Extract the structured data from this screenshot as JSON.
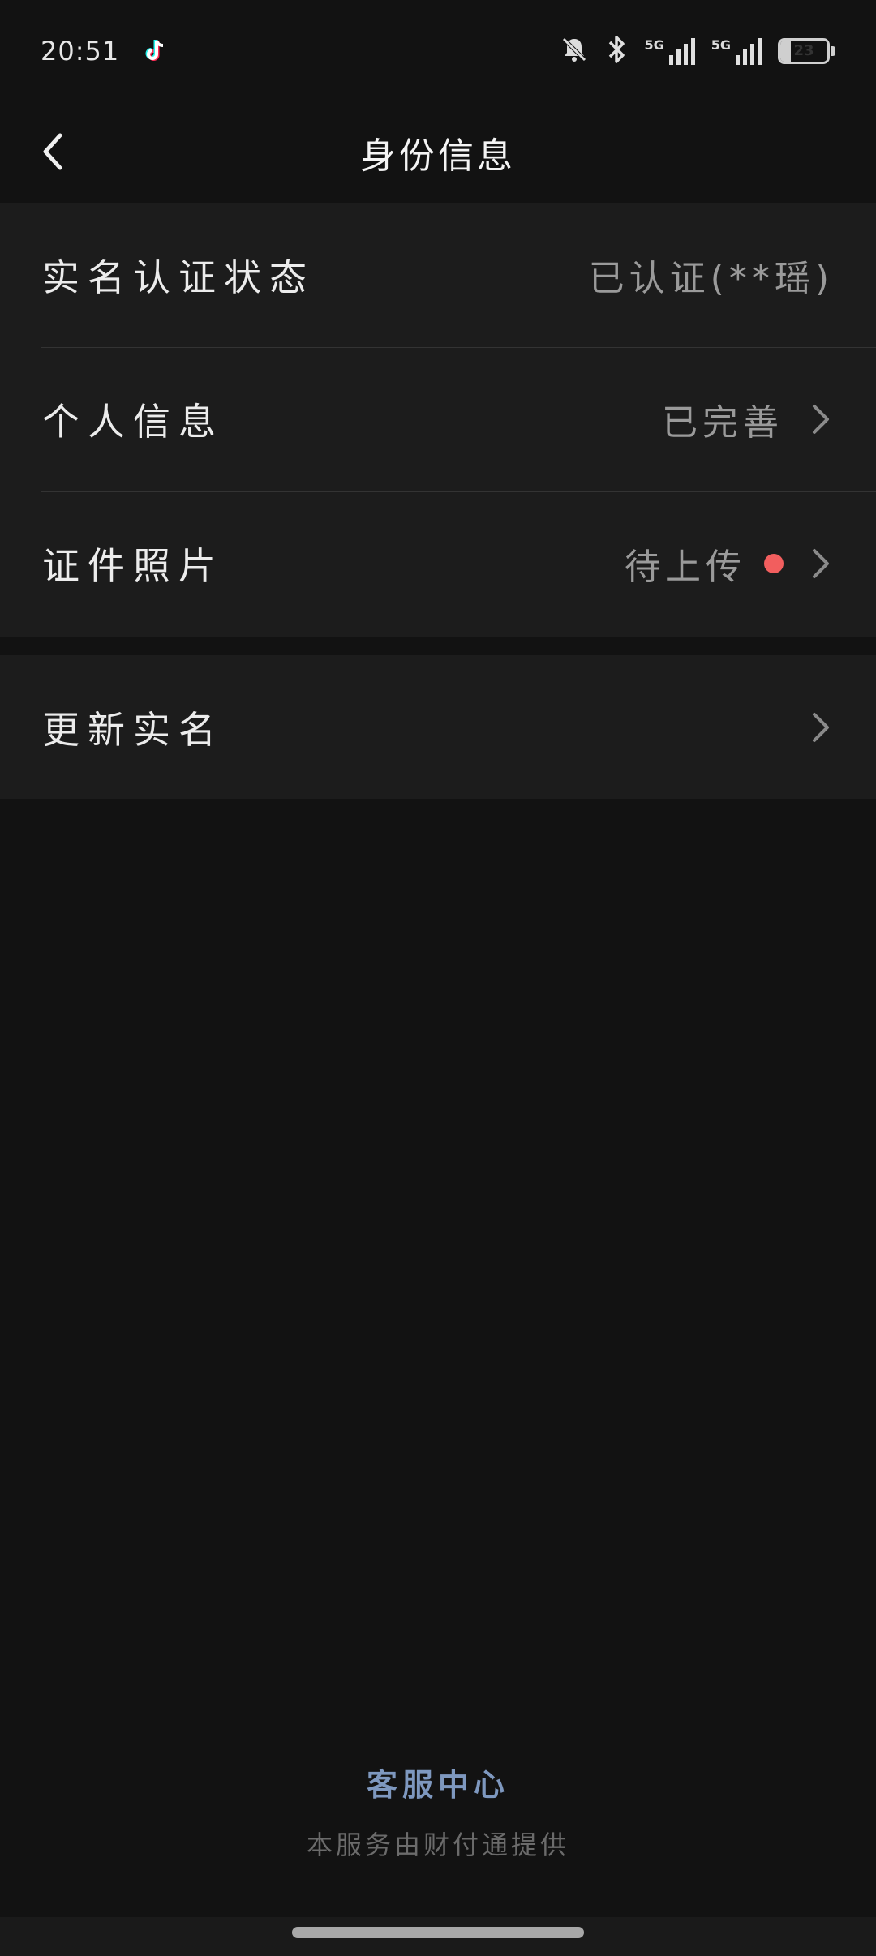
{
  "status_bar": {
    "time": "20:51",
    "app_icon": "tiktok-icon",
    "icons": [
      "bell-muted-icon",
      "bluetooth-icon",
      "signal-5g-icon",
      "signal-5g-icon"
    ],
    "signal_label_1": "5G",
    "signal_label_2": "5G",
    "battery_level": "23",
    "battery_fraction": 0.23
  },
  "header": {
    "title": "身份信息",
    "back_icon": "chevron-left-icon"
  },
  "info_group": {
    "items": [
      {
        "label": "实名认证状态",
        "value": "已认证(**瑶)",
        "has_chevron": false
      },
      {
        "label": "个人信息",
        "value": "已完善",
        "has_chevron": true
      },
      {
        "label": "证件照片",
        "value": "待上传",
        "has_chevron": true,
        "badge_color": "#f25e5e"
      }
    ]
  },
  "action_group": {
    "items": [
      {
        "label": "更新实名",
        "has_chevron": true
      }
    ]
  },
  "footer": {
    "link_label": "客服中心",
    "note": "本服务由财付通提供"
  },
  "colors": {
    "background": "#121212",
    "card": "#1c1c1c",
    "accent_link": "#7e98bf",
    "badge": "#f25e5e"
  }
}
